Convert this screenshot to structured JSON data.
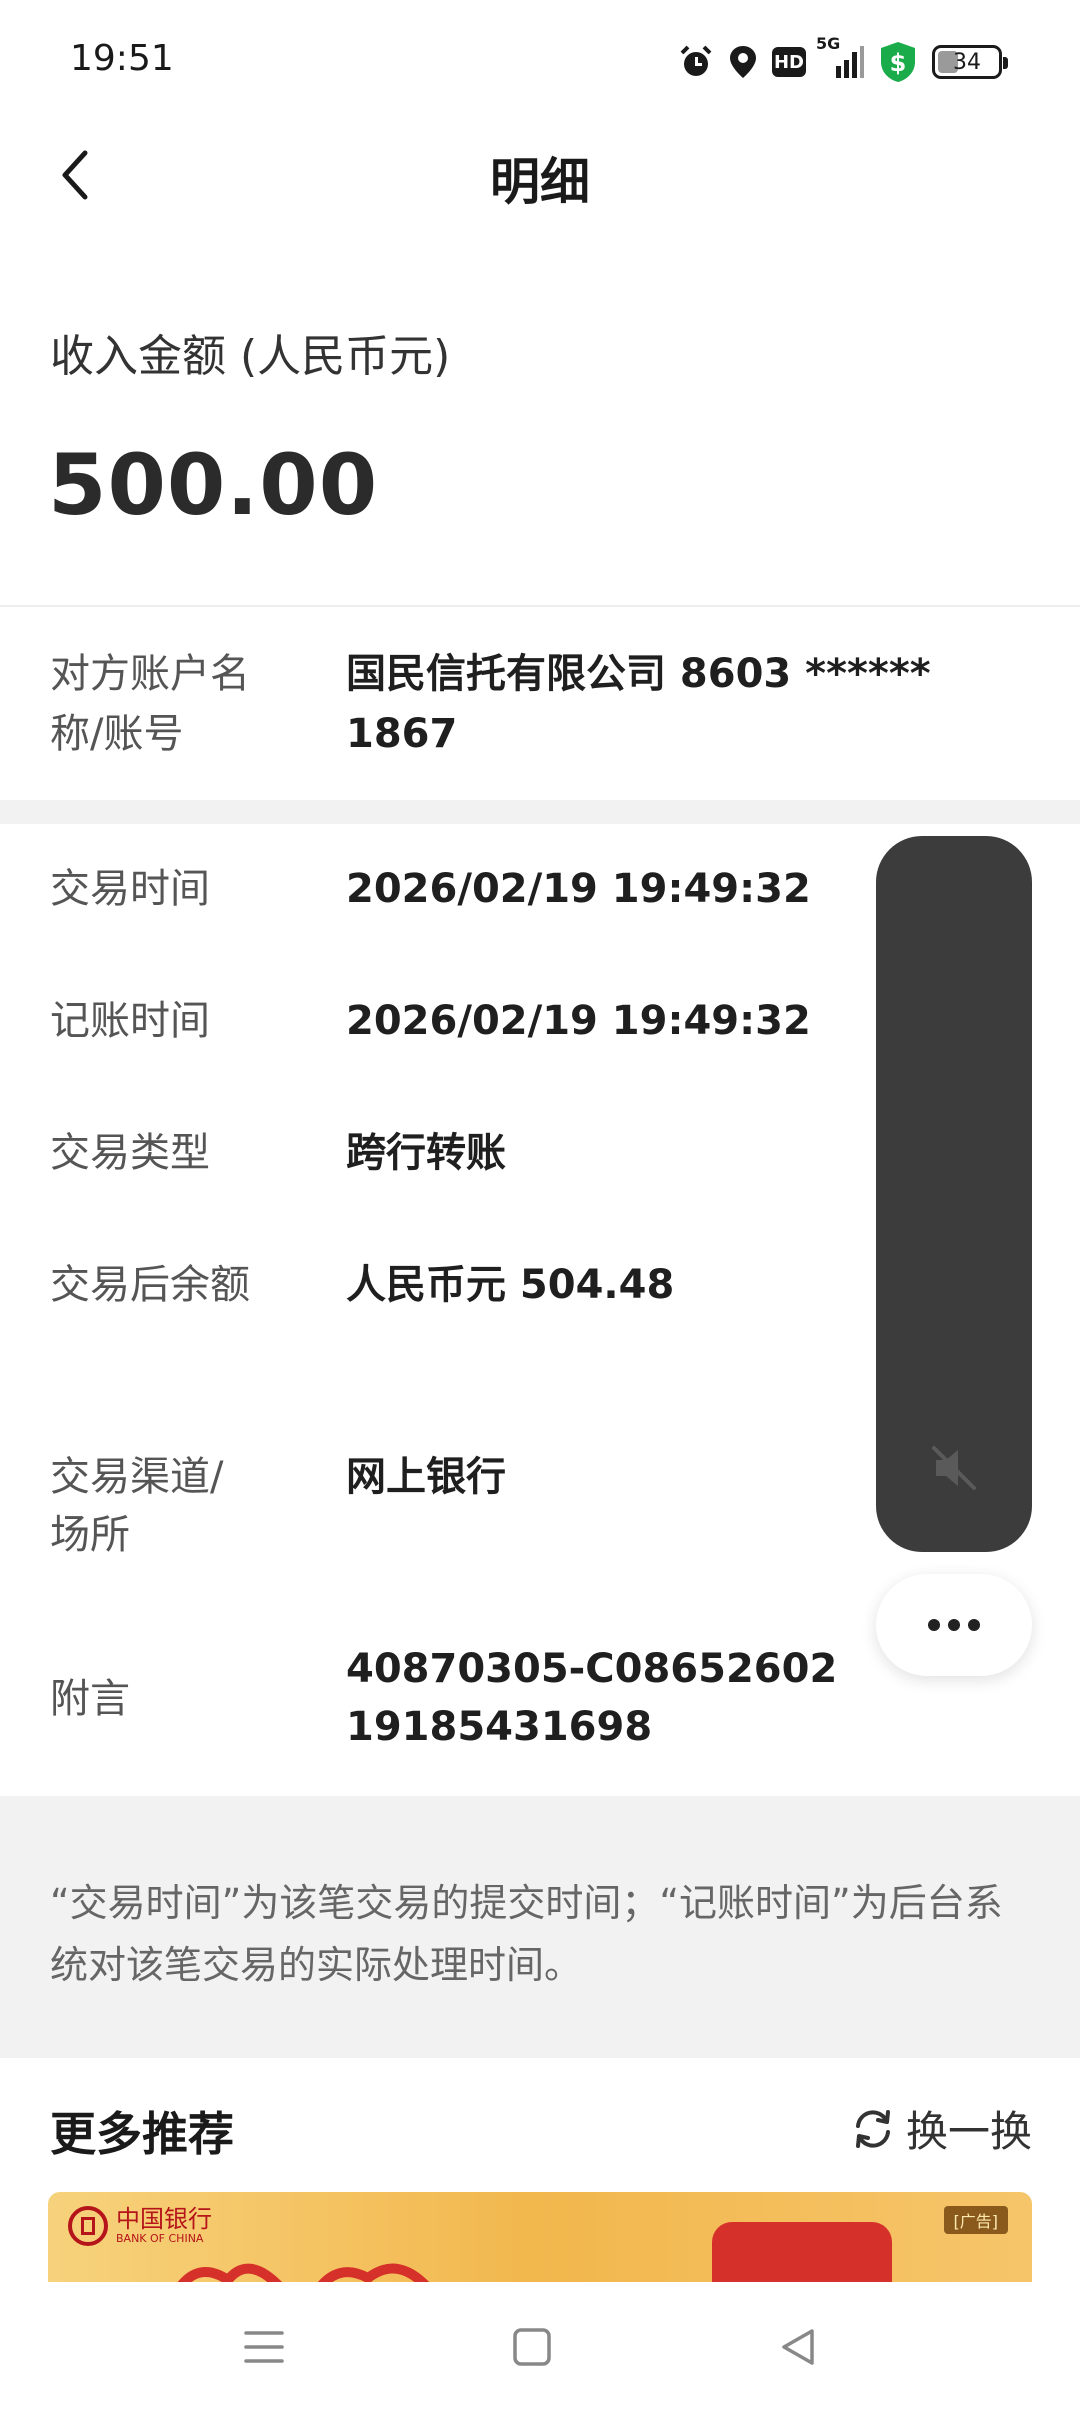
{
  "status_bar": {
    "time": "19:51",
    "network": "5G",
    "hd_label": "HD",
    "battery": "34",
    "battery_level_percent": 34,
    "icons": [
      "alarm-icon",
      "location-icon",
      "hd-icon",
      "signal-5g-icon",
      "security-shield-icon",
      "battery-icon"
    ]
  },
  "header": {
    "title": "明细",
    "back_icon": "chevron-left-icon"
  },
  "amount": {
    "label": "收入金额 (人民币元)",
    "value": "500.00"
  },
  "counterparty": {
    "label": "对方账户名称/账号",
    "value": "国民信托有限公司 8603 ****** 1867"
  },
  "details": [
    {
      "label": "交易时间",
      "value": "2026/02/19 19:49:32"
    },
    {
      "label": "记账时间",
      "value": "2026/02/19 19:49:32"
    },
    {
      "label": "交易类型",
      "value": "跨行转账"
    },
    {
      "label": "交易后余额",
      "value": "人民币元 504.48"
    },
    {
      "label": "交易渠道/场所",
      "value": "网上银行"
    },
    {
      "label": "附言",
      "value": "40870305-C0865260219185431698"
    }
  ],
  "note": "“交易时间”为该笔交易的提交时间；“记账时间”为后台系统对该笔交易的实际处理时间。",
  "recommend": {
    "title": "更多推荐",
    "refresh_label": "换一换",
    "banner": {
      "brand": "中国银行",
      "brand_en": "BANK OF CHINA",
      "ad_tag": "[广告]"
    }
  },
  "colors": {
    "accent_green": "#1aab4b",
    "text_primary": "#1f1f1f",
    "text_secondary": "#555555",
    "overlay": "#3c3c3c",
    "band": "#f2f2f2",
    "boc_red": "#b5141b"
  }
}
